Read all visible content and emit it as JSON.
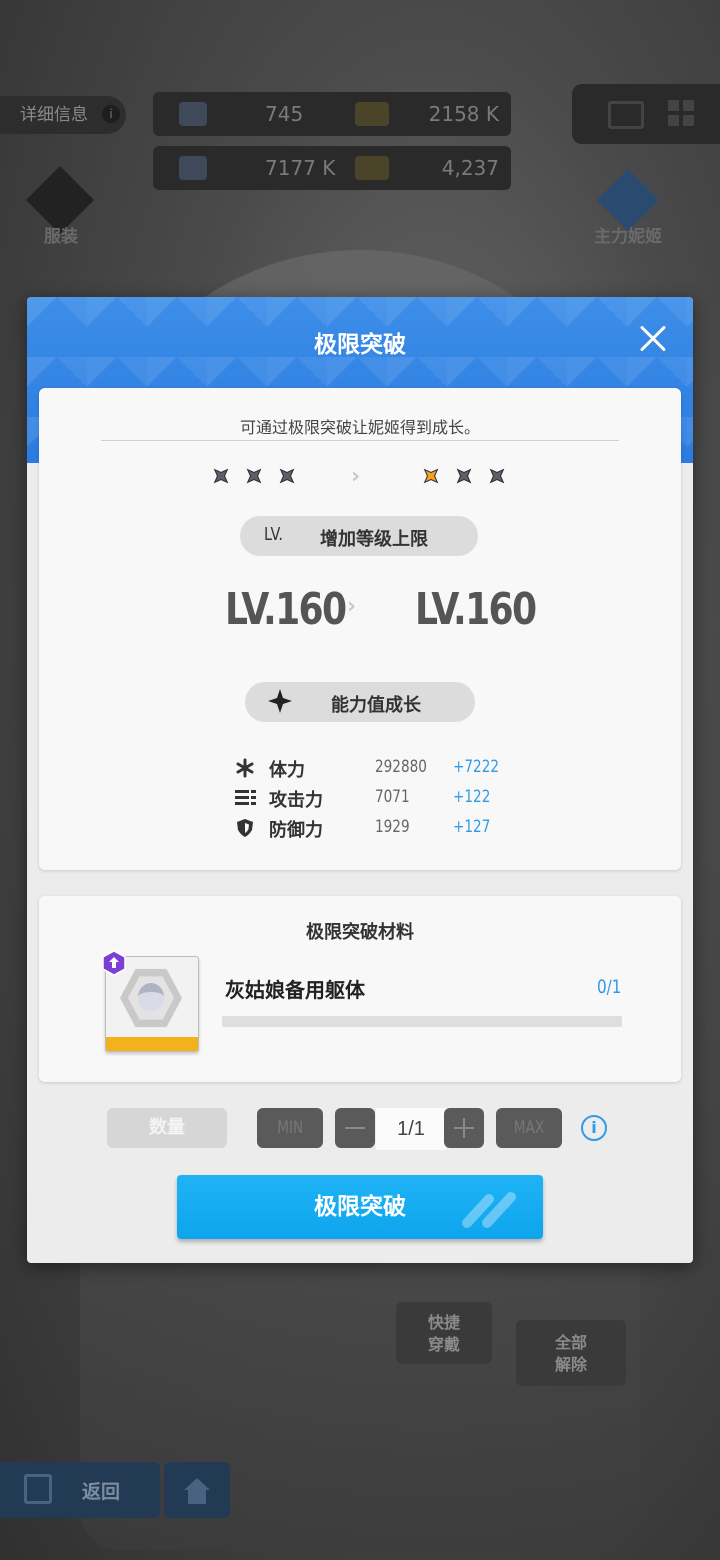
{
  "background": {
    "info_label": "详细信息",
    "resources": [
      {
        "value_a": "745",
        "value_b": "2158 K"
      },
      {
        "value_a": "7177 K",
        "value_b": "4,237"
      }
    ],
    "left_badge_label": "服装",
    "right_badge_label": "主力妮姬",
    "quick_equip_label": "快捷穿戴",
    "unequip_all_label": "全部解除",
    "back_label": "返回"
  },
  "modal": {
    "title": "极限突破",
    "description": "可通过极限突破让妮姬得到成长。",
    "stars_before": [
      "gray",
      "gray",
      "gray"
    ],
    "stars_after": [
      "orange",
      "gray",
      "gray"
    ],
    "level_pill": {
      "prefix": "LV.",
      "label": "增加等级上限"
    },
    "level_before": "LV.160",
    "level_after": "LV.160",
    "ability_pill_label": "能力值成长",
    "stats": [
      {
        "icon": "asterisk-icon",
        "name": "体力",
        "value": "292880",
        "increase": "+7222"
      },
      {
        "icon": "bullets-icon",
        "name": "攻击力",
        "value": "7071",
        "increase": "+122"
      },
      {
        "icon": "shield-icon",
        "name": "防御力",
        "value": "1929",
        "increase": "+127"
      }
    ],
    "materials": {
      "title": "极限突破材料",
      "item_name": "灰姑娘备用躯体",
      "count": "0/1",
      "progress": 0
    },
    "quantity": {
      "label": "数量",
      "min_label": "MIN",
      "max_label": "MAX",
      "value": "1/1"
    },
    "confirm_label": "极限突破"
  },
  "colors": {
    "accent_blue": "#2f9be8",
    "header_blue": "#2a7be0",
    "star_orange": "#f5a020",
    "star_gray": "#5c6066",
    "rarity_purple": "#7b3fd6"
  }
}
